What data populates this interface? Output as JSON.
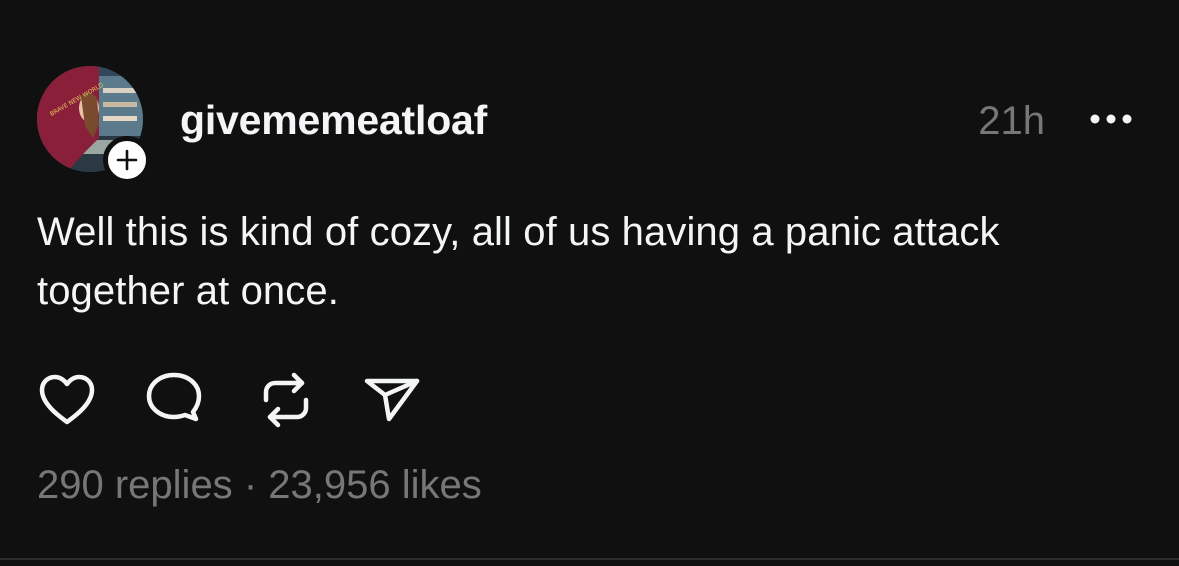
{
  "post": {
    "username": "givememeatloaf",
    "timestamp": "21h",
    "text": "Well this is kind of cozy, all of us having a panic attack together at once.",
    "replies": "290 replies",
    "separator": "·",
    "likes": "23,956 likes"
  },
  "avatar_shirt_text": "BRAVE NEW WORLD",
  "icons": {
    "follow": "plus-icon",
    "more": "more-horizontal-icon",
    "like": "heart-icon",
    "reply": "comment-icon",
    "repost": "repost-icon",
    "share": "send-icon"
  },
  "colors": {
    "background": "#101010",
    "primary_text": "#f3f5f7",
    "secondary_text": "#777777"
  }
}
